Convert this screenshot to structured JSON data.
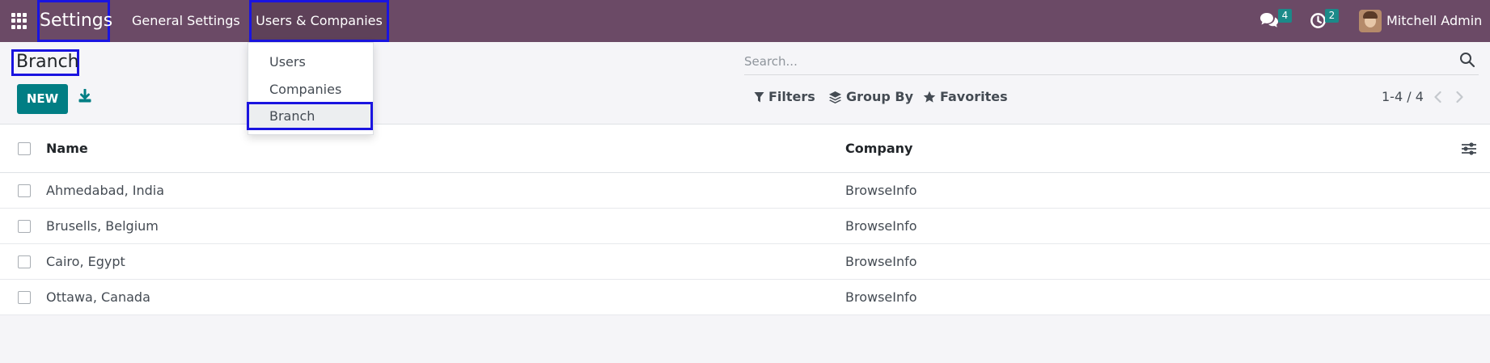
{
  "navbar": {
    "app_name": "Settings",
    "menu": {
      "general_settings": "General Settings",
      "users_companies": "Users & Companies"
    },
    "chat_count": "4",
    "activity_count": "2",
    "user_name": "Mitchell Admin",
    "icons": [
      "apps-grid-icon",
      "chat-icon",
      "clock-icon",
      "avatar"
    ]
  },
  "dropdown": {
    "items": [
      "Users",
      "Companies",
      "Branch"
    ],
    "active": "Branch"
  },
  "control_panel": {
    "title": "Branch",
    "new_label": "NEW",
    "search_placeholder": "Search...",
    "filters_label": "Filters",
    "groupby_label": "Group By",
    "favorites_label": "Favorites",
    "pager": "1-4 / 4"
  },
  "list": {
    "columns": [
      "Name",
      "Company"
    ],
    "rows": [
      {
        "name": "Ahmedabad, India",
        "company": "BrowseInfo"
      },
      {
        "name": "Brusells, Belgium",
        "company": "BrowseInfo"
      },
      {
        "name": "Cairo, Egypt",
        "company": "BrowseInfo"
      },
      {
        "name": "Ottawa, Canada",
        "company": "BrowseInfo"
      }
    ]
  },
  "colors": {
    "navbar": "#6b4a66",
    "primary_button": "#017e84",
    "badge": "#1b8a89",
    "highlight_box": "#1a14e0"
  }
}
